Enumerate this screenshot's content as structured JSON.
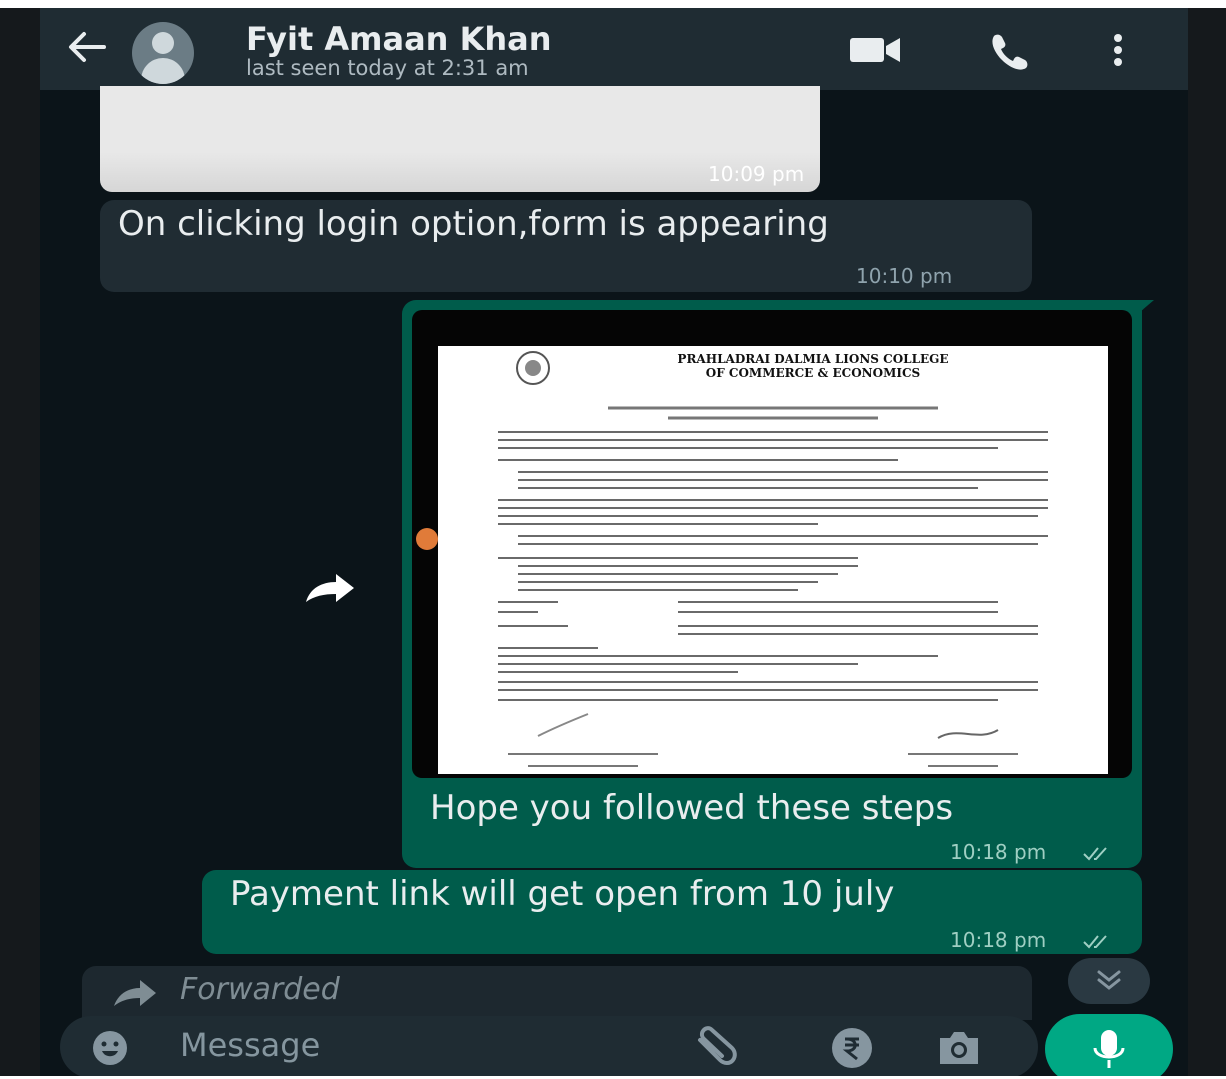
{
  "header": {
    "contact_name": "Fyit Amaan Khan",
    "last_seen": "last seen today at 2:31 am",
    "icons": [
      "back-arrow-icon",
      "avatar-icon",
      "video-call-icon",
      "phone-icon",
      "more-options-icon"
    ]
  },
  "messages": [
    {
      "direction": "incoming",
      "type": "image",
      "time": "10:09 pm"
    },
    {
      "direction": "incoming",
      "type": "text",
      "text": "On clicking login option,form is appearing",
      "time": "10:10 pm"
    },
    {
      "direction": "outgoing",
      "type": "image-with-caption",
      "document": {
        "title_line1": "PRAHLADRAI DALMIA LIONS COLLEGE",
        "title_line2": "OF COMMERCE & ECONOMICS"
      },
      "caption": "Hope you followed these steps",
      "time": "10:18 pm",
      "status": "read"
    },
    {
      "direction": "outgoing",
      "type": "text",
      "text": "Payment link will get open from 10 july",
      "time": "10:18 pm",
      "status": "read"
    }
  ],
  "composer": {
    "forwarded_label": "Forwarded",
    "placeholder": "Message",
    "icons": [
      "emoji-icon",
      "attach-icon",
      "rupee-icon",
      "camera-icon",
      "mic-icon",
      "scroll-down-icon"
    ]
  },
  "colors": {
    "header_bg": "#1f2c33",
    "chat_bg": "#0b1419",
    "incoming_bubble": "#202c33",
    "outgoing_bubble": "#005c4b",
    "accent": "#00a884"
  }
}
